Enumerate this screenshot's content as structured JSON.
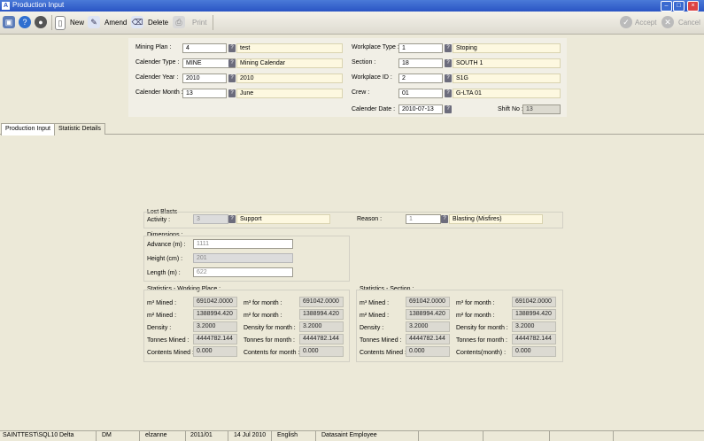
{
  "window": {
    "title": "Production Input"
  },
  "toolbar": {
    "new_label": "New",
    "amend_label": "Amend",
    "delete_label": "Delete",
    "print_label": "Print",
    "accept_label": "Accept",
    "cancel_label": "Cancel"
  },
  "header": {
    "mining_plan": {
      "label": "Mining Plan :",
      "value": "4",
      "desc": "test"
    },
    "calender_type": {
      "label": "Calender Type :",
      "value": "MINE",
      "desc": "Mining Calendar"
    },
    "calender_year": {
      "label": "Calender Year :",
      "value": "2010",
      "desc": "2010"
    },
    "calender_month": {
      "label": "Calender Month :",
      "value": "13",
      "desc": "June"
    },
    "workplace_type": {
      "label": "Workplace Type :",
      "value": "1",
      "desc": "Stoping"
    },
    "section": {
      "label": "Section :",
      "value": "18",
      "desc": "SOUTH 1"
    },
    "workplace_id": {
      "label": "Workplace ID :",
      "value": "2",
      "desc": "S1G"
    },
    "crew": {
      "label": "Crew :",
      "value": "01",
      "desc": "G-LTA 01"
    },
    "calender_date": {
      "label": "Calender Date :",
      "value": "2010-07-13"
    },
    "shift_no": {
      "label": "Shift No :",
      "value": "13"
    },
    "lookup_glyph": "?"
  },
  "tabs": [
    {
      "label": "Production Input"
    },
    {
      "label": "Statistic Details"
    }
  ],
  "lost_blasts": {
    "title": "Lost Blasts",
    "activity_label": "Activity :",
    "activity_value": "3",
    "activity_desc": "Support",
    "reason_label": "Reason :",
    "reason_value": "1",
    "reason_desc": "Blasting (Misfires)"
  },
  "dimensions": {
    "title": "Dimensions :",
    "advance_label": "Advance (m) :",
    "advance_value": "1111",
    "height_label": "Height (cm) :",
    "height_value": "201",
    "length_label": "Length (m) :",
    "length_value": "622"
  },
  "stats_wp": {
    "title": "Statistics - Working Place :",
    "m3_mined_label": "m³ Mined :",
    "m3_mined_value": "691042.0000",
    "m3_month_label": "m³  for month :",
    "m3_month_value": "691042.0000",
    "m2_mined_label": "m² Mined :",
    "m2_mined_value": "1388994.420",
    "m2_month_label": "m²  for month :",
    "m2_month_value": "1388994.420",
    "density_label": "Density :",
    "density_value": "3.2000",
    "density_month_label": "Density for month :",
    "density_month_value": "3.2000",
    "tonnes_label": "Tonnes Mined :",
    "tonnes_value": "4444782.144",
    "tonnes_month_label": "Tonnes for month :",
    "tonnes_month_value": "4444782.144",
    "contents_label": "Contents Mined :",
    "contents_value": "0.000",
    "contents_month_label": "Contents for month :",
    "contents_month_value": "0.000"
  },
  "stats_sec": {
    "title": "Statistics - Section :",
    "m3_mined_label": "m³ Mined :",
    "m3_mined_value": "691042.0000",
    "m3_month_label": "m³  for month :",
    "m3_month_value": "691042.0000",
    "m2_mined_label": "m² Mined :",
    "m2_mined_value": "1388994.420",
    "m2_month_label": "m²  for month :",
    "m2_month_value": "1388994.420",
    "density_label": "Density :",
    "density_value": "3.2000",
    "density_month_label": "Density for month :",
    "density_month_value": "3.2000",
    "tonnes_label": "Tonnes Mined :",
    "tonnes_value": "4444782.144",
    "tonnes_month_label": "Tonnes for month :",
    "tonnes_month_value": "4444782.144",
    "contents_label": "Contents Mined :",
    "contents_value": "0.000",
    "contents_month_label": "Contents(month) :",
    "contents_month_value": "0.000"
  },
  "statusbar": {
    "server": "SAINTTEST\\SQL10",
    "mode": "Delta",
    "module": "DM",
    "user": "elzanne",
    "period": "2011/01",
    "date": "14 Jul 2010",
    "language": "English",
    "company": "Datasaint Employee"
  },
  "colors": {
    "titlebar": "#2a55c4",
    "window_bg": "#ece9d8",
    "desc_field_bg": "#fdf8e0",
    "readonly_bg": "#dcdad0"
  }
}
